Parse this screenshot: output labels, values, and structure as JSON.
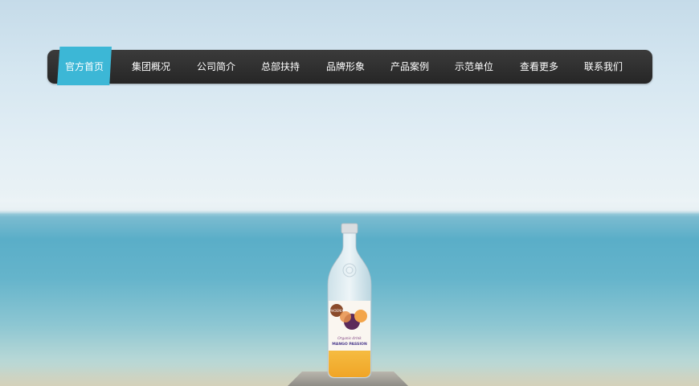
{
  "nav": {
    "items": [
      {
        "label": "官方首页",
        "active": true
      },
      {
        "label": "集团概况",
        "active": false
      },
      {
        "label": "公司简介",
        "active": false
      },
      {
        "label": "总部扶持",
        "active": false
      },
      {
        "label": "品牌形象",
        "active": false
      },
      {
        "label": "产品案例",
        "active": false
      },
      {
        "label": "示范单位",
        "active": false
      },
      {
        "label": "查看更多",
        "active": false
      },
      {
        "label": "联系我们",
        "active": false
      }
    ]
  },
  "hero": {
    "bottle_label": {
      "brand": "PHOENIX",
      "line1": "Organic drink",
      "line2": "MANGO PASSION"
    }
  },
  "colors": {
    "nav_bg": "#2e2e2e",
    "nav_active": "#3cb7d6",
    "nav_text": "#ffffff"
  }
}
